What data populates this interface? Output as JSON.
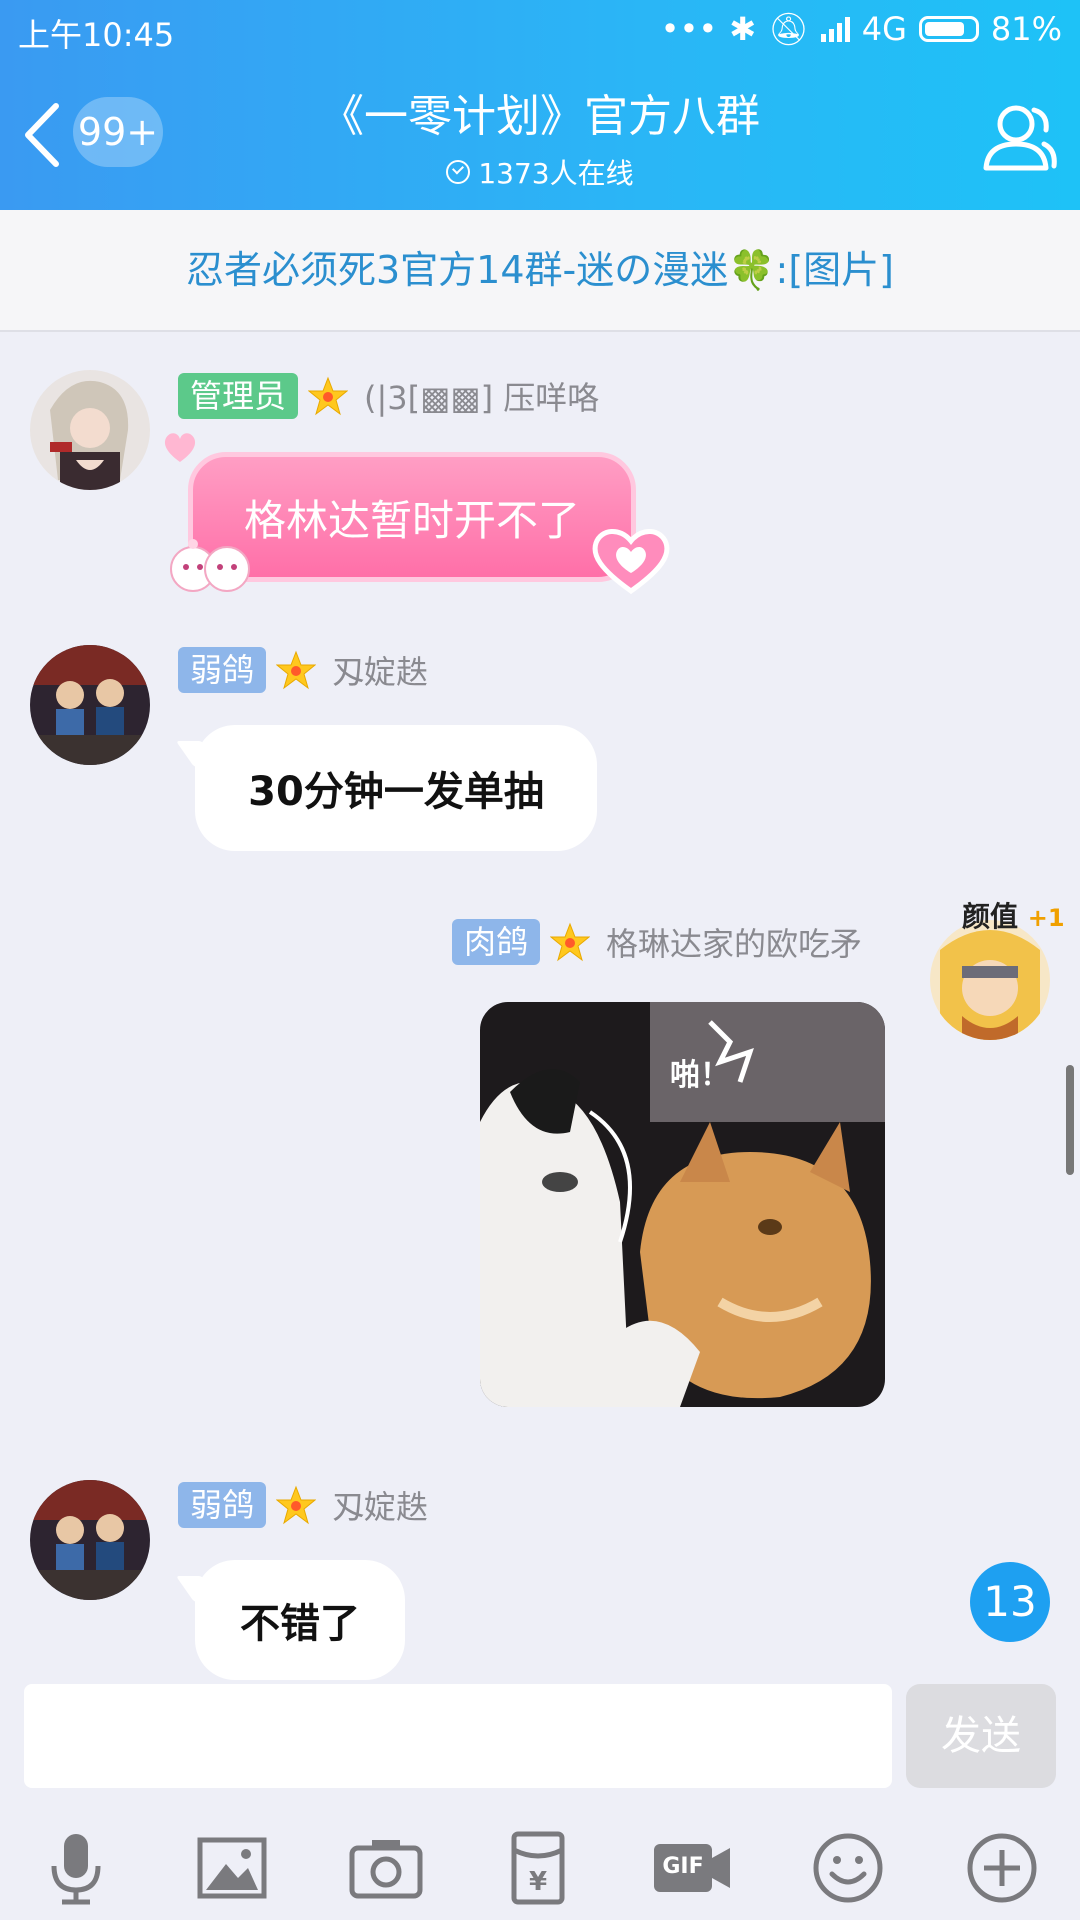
{
  "status_bar": {
    "time": "上午10:45",
    "network": "4G",
    "battery": "81%"
  },
  "header": {
    "unread_count": "99+",
    "title": "《一零计划》官方八群",
    "online": "1373人在线"
  },
  "notice": {
    "text": "忍者必须死3官方14群-迷の漫迷🍀:[图片]"
  },
  "messages": [
    {
      "badge": "管理员",
      "name": "(|3[▩▩] 压咩咯",
      "text": "格林达暂时开不了"
    },
    {
      "badge": "弱鸽",
      "name": "刄婝趃",
      "text": "30分钟一发单抽"
    },
    {
      "badge": "肉鸽",
      "name": "格琳达家的欧吃矛",
      "image_caption": "啪！",
      "avatar_tag": "颜值",
      "avatar_tag_extra": "+1"
    },
    {
      "badge": "弱鸽",
      "name": "刄婝趃",
      "text": "不错了"
    }
  ],
  "new_message_count": "13",
  "composer": {
    "placeholder": "",
    "send_label": "发送"
  },
  "toolbar": {
    "gif_label": "GIF"
  },
  "colors": {
    "header_start": "#3a9af2",
    "header_end": "#1ec2f7",
    "admin_badge": "#5cc98a",
    "level_badge": "#8eb6ea",
    "float_badge": "#1ea0f1"
  }
}
